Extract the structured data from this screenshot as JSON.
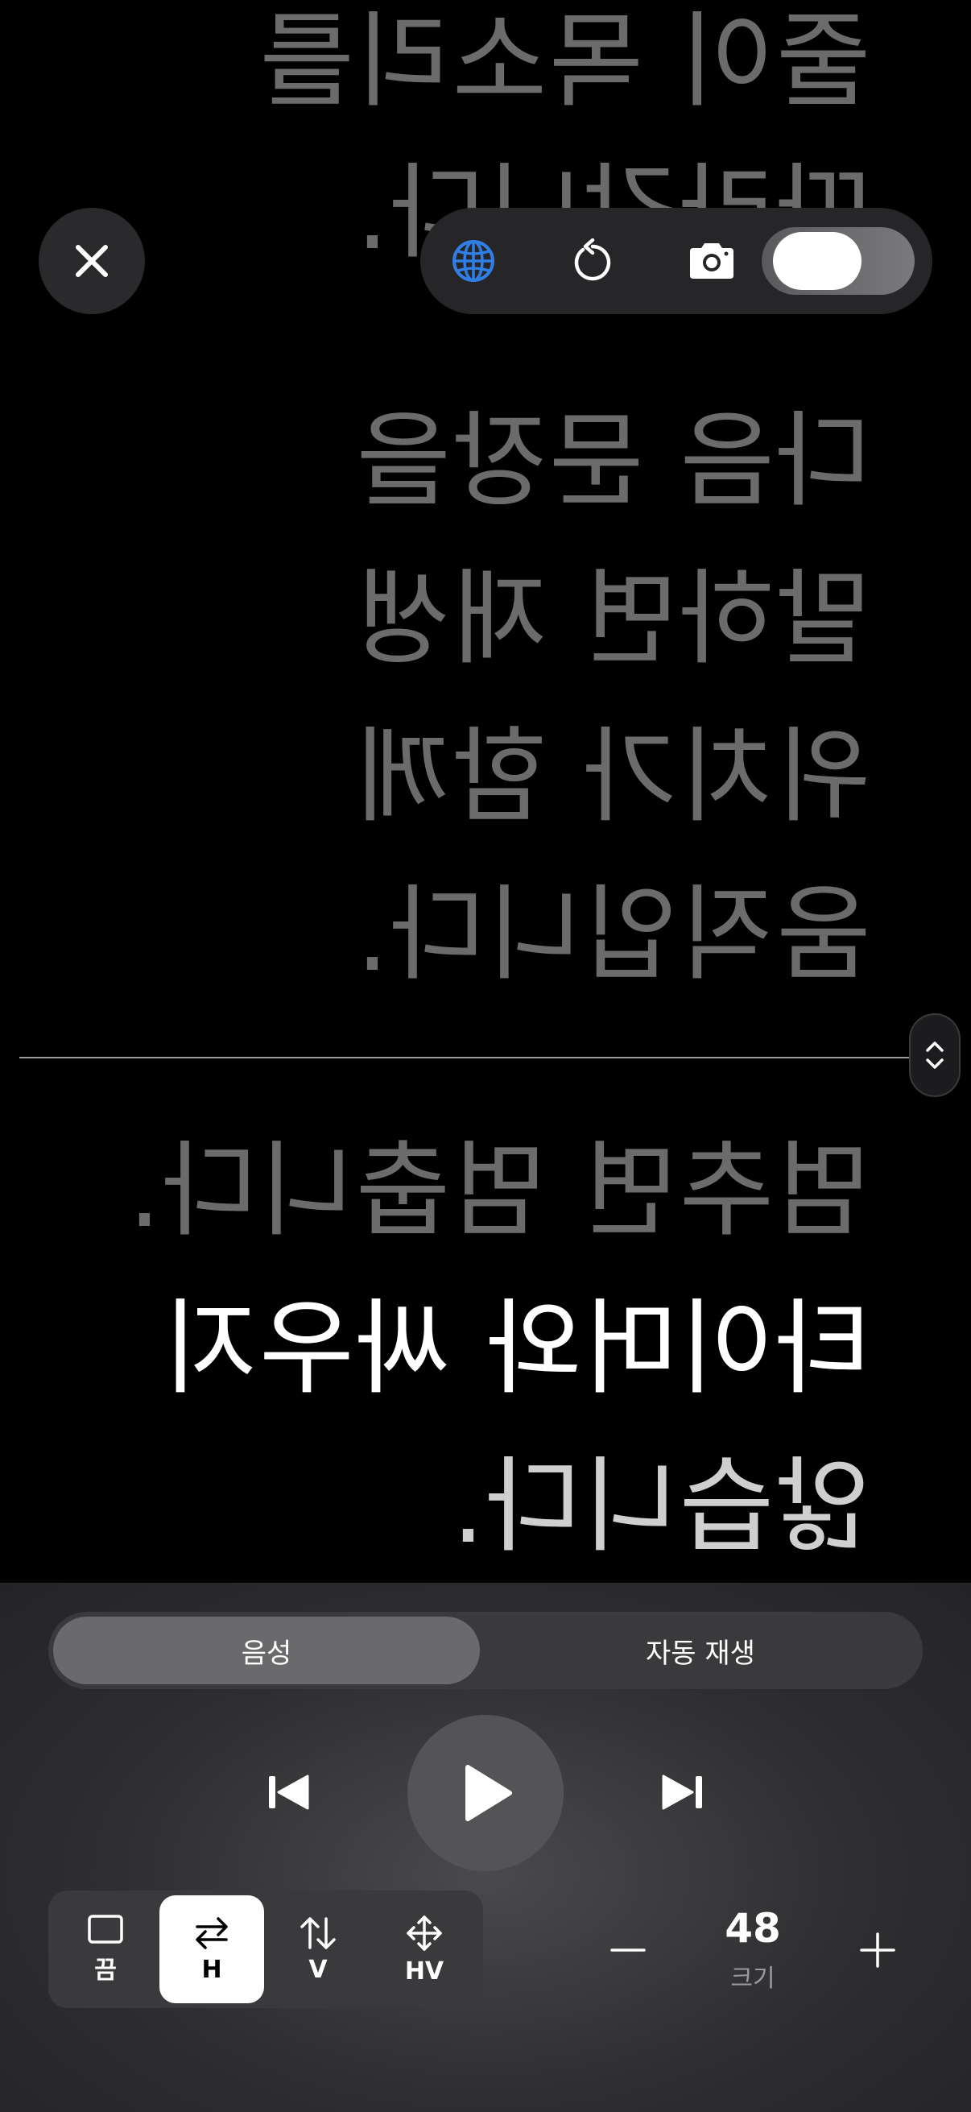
{
  "prompter": {
    "lines": [
      "줄이 목소리를",
      "따라갑니다.",
      "다음 문장을",
      "말하면 재생",
      "위치가 함께",
      "움직입니다.",
      "멈추면 멈춥니다.",
      "타이머와 싸우지",
      "않습니다."
    ],
    "mirrored": true
  },
  "toolbar": {
    "icons": [
      "close-icon",
      "globe-icon",
      "restart-icon",
      "camera-icon"
    ],
    "mirror_toggle_on": true,
    "accent_color": "#2f7fe6"
  },
  "segment": {
    "voice_label": "음성",
    "auto_label": "자동 재생",
    "selected": "음성"
  },
  "transport": {
    "icons": [
      "skip-back-icon",
      "play-icon",
      "skip-forward-icon"
    ]
  },
  "scroll_modes": [
    {
      "label": "끔",
      "icon": "square-icon"
    },
    {
      "label": "H",
      "icon": "horizontal-arrows-icon"
    },
    {
      "label": "V",
      "icon": "vertical-arrows-icon"
    },
    {
      "label": "HV",
      "icon": "move-arrows-icon"
    }
  ],
  "active_mode": "H",
  "size": {
    "value": "48",
    "label": "크기"
  }
}
